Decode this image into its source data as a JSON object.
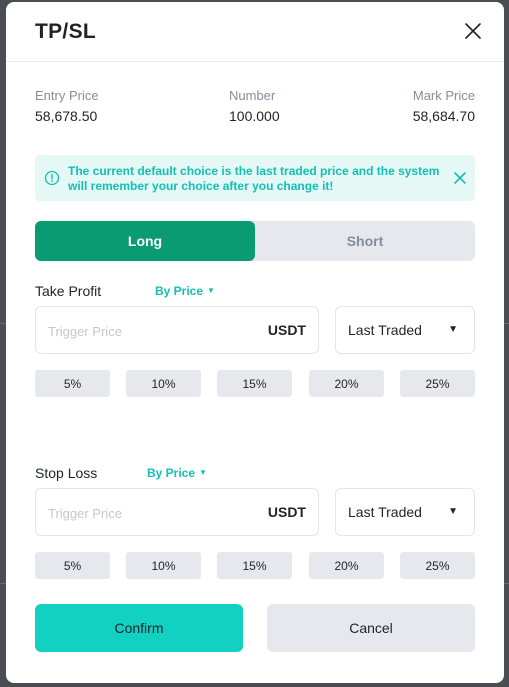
{
  "modal": {
    "title": "TP/SL"
  },
  "info": {
    "entry_price_label": "Entry Price",
    "entry_price_value": "58,678.50",
    "number_label": "Number",
    "number_value": "100.000",
    "mark_price_label": "Mark Price",
    "mark_price_value": "58,684.70"
  },
  "notice": {
    "text": "The current default choice is the last traded price and the system will remember your choice after you change it!"
  },
  "toggle": {
    "long_label": "Long",
    "short_label": "Short",
    "selected": "Long"
  },
  "take_profit": {
    "label": "Take Profit",
    "mode_label": "By Price",
    "input_value": "",
    "input_placeholder": "Trigger Price",
    "unit": "USDT",
    "price_type": "Last Traded",
    "percents": [
      "5%",
      "10%",
      "15%",
      "20%",
      "25%"
    ]
  },
  "stop_loss": {
    "label": "Stop Loss",
    "mode_label": "By Price",
    "input_value": "",
    "input_placeholder": "Trigger Price",
    "unit": "USDT",
    "price_type": "Last Traded",
    "percents": [
      "5%",
      "10%",
      "15%",
      "20%",
      "25%"
    ]
  },
  "actions": {
    "confirm_label": "Confirm",
    "cancel_label": "Cancel"
  },
  "colors": {
    "accent": "#12c0b4",
    "long_active": "#0b9b72",
    "confirm_bg": "#12d1c2"
  },
  "icons": {
    "close": "close-icon",
    "info": "info-circle-icon",
    "notice_close": "close-icon",
    "mode_caret": "caret-down-icon",
    "select_caret": "caret-down-icon"
  }
}
